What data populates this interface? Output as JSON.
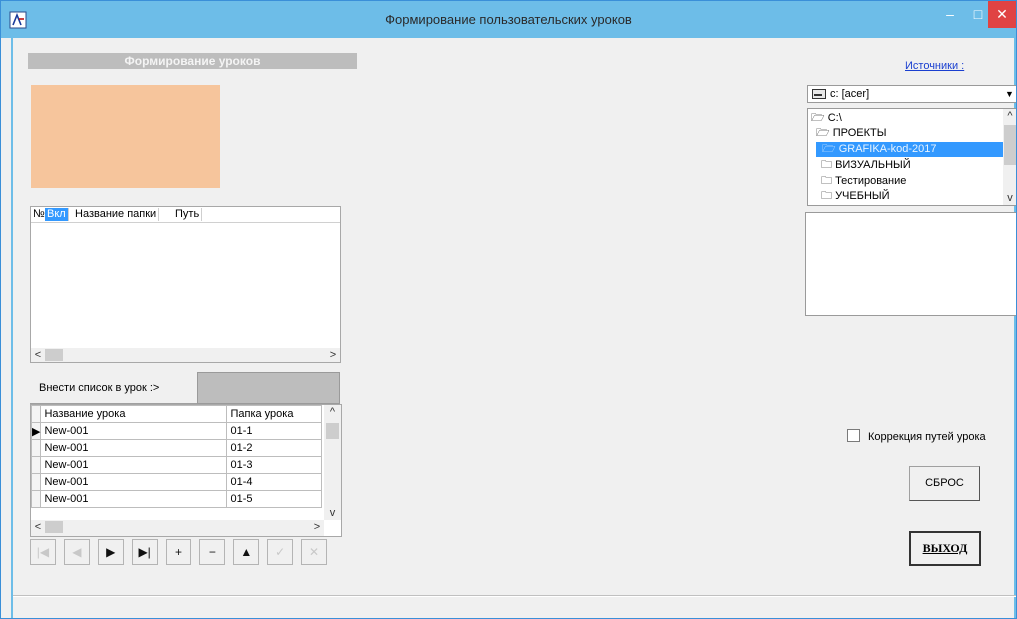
{
  "window": {
    "title": "Формирование пользовательских уроков",
    "controls": {
      "minimize": "–",
      "maximize": "□",
      "close": "✕"
    }
  },
  "left_panel": {
    "section_title": "Формирование уроков",
    "preview_color": "#f6c59c",
    "folder_grid": {
      "columns": [
        "№",
        "Вкл",
        "Название папки",
        "Путь"
      ],
      "rows": []
    },
    "enter_list_label": "Внести список в урок :>",
    "lessons_grid": {
      "columns": [
        "Название урока",
        "Папка урока"
      ],
      "rows": [
        {
          "name": "New-001",
          "folder": "01-1"
        },
        {
          "name": "New-001",
          "folder": "01-2"
        },
        {
          "name": "New-001",
          "folder": "01-3"
        },
        {
          "name": "New-001",
          "folder": "01-4"
        },
        {
          "name": "New-001",
          "folder": "01-5"
        }
      ]
    },
    "navigator": [
      "|◀",
      "◀",
      "▶",
      "▶|",
      "+",
      "−",
      "▲",
      "✓",
      "✕"
    ]
  },
  "right_panel": {
    "sources_link": "Источники :",
    "drive": "c: [acer]",
    "folders": [
      {
        "label": "C:\\",
        "level": 0,
        "selected": false
      },
      {
        "label": "ПРОЕКТЫ",
        "level": 1,
        "selected": false
      },
      {
        "label": "GRAFIKA-kod-2017",
        "level": 2,
        "selected": true
      },
      {
        "label": "ВИЗУАЛЬНЫЙ",
        "level": 3,
        "selected": false
      },
      {
        "label": "Тестирование",
        "level": 3,
        "selected": false
      },
      {
        "label": "УЧЕБНЫЙ",
        "level": 3,
        "selected": false
      }
    ],
    "correction_checkbox": {
      "label": "Коррекция путей урока",
      "checked": false
    },
    "reset_button": "СБРОС",
    "exit_button": "ВЫХОД"
  },
  "colors": {
    "titlebar": "#6dbde8",
    "selection": "#3399ff",
    "close": "#e04343"
  }
}
